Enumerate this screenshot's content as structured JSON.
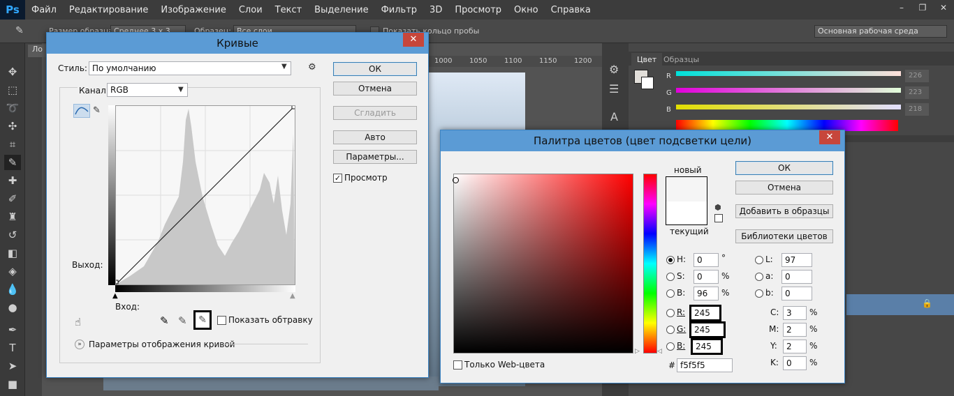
{
  "menu": {
    "logo": "Ps",
    "items": [
      "Файл",
      "Редактирование",
      "Изображение",
      "Слои",
      "Текст",
      "Выделение",
      "Фильтр",
      "3D",
      "Просмотр",
      "Окно",
      "Справка"
    ]
  },
  "window_controls": [
    "–",
    "❐",
    "✕"
  ],
  "options": {
    "sample_size_label": "Размер образца:",
    "sample_size_value": "Среднее 3 х 3",
    "sample_label": "Образец:",
    "sample_value": "Все слои",
    "show_ring": "Показать кольцо пробы",
    "workspace": "Основная рабочая среда"
  },
  "doc_tab": "Ло",
  "ruler_ticks": [
    "1000",
    "1050",
    "1100",
    "1150",
    "1200"
  ],
  "right_panel": {
    "tabs": [
      "Цвет",
      "Образцы"
    ],
    "channels": [
      {
        "label": "R",
        "value": "226"
      },
      {
        "label": "G",
        "value": "223"
      },
      {
        "label": "B",
        "value": "218"
      }
    ]
  },
  "curves": {
    "title": "Кривые",
    "close": "✕",
    "style_label": "Стиль:",
    "style_value": "По умолчанию",
    "channel_label": "Канал:",
    "channel_value": "RGB",
    "output_label": "Выход:",
    "input_label": "Вход:",
    "show_clipping": "Показать обтравку",
    "display_options": "Параметры отображения кривой",
    "preview": "Просмотр",
    "buttons": {
      "ok": "ОК",
      "cancel": "Отмена",
      "smooth": "Сгладить",
      "auto": "Авто",
      "options": "Параметры..."
    }
  },
  "picker": {
    "title": "Палитра цветов (цвет подсветки цели)",
    "close": "✕",
    "new_label": "новый",
    "current_label": "текущий",
    "buttons": {
      "ok": "ОК",
      "cancel": "Отмена",
      "add": "Добавить в образцы",
      "libraries": "Библиотеки цветов"
    },
    "web_only": "Только Web-цвета",
    "hsb": [
      {
        "label": "H:",
        "value": "0",
        "unit": "°"
      },
      {
        "label": "S:",
        "value": "0",
        "unit": "%"
      },
      {
        "label": "B:",
        "value": "96",
        "unit": "%"
      }
    ],
    "rgb": [
      {
        "label": "R:",
        "value": "245"
      },
      {
        "label": "G:",
        "value": "245"
      },
      {
        "label": "B:",
        "value": "245"
      }
    ],
    "lab": [
      {
        "label": "L:",
        "value": "97"
      },
      {
        "label": "a:",
        "value": "0"
      },
      {
        "label": "b:",
        "value": "0"
      }
    ],
    "cmyk": [
      {
        "label": "C:",
        "value": "3",
        "unit": "%"
      },
      {
        "label": "M:",
        "value": "2",
        "unit": "%"
      },
      {
        "label": "Y:",
        "value": "2",
        "unit": "%"
      },
      {
        "label": "K:",
        "value": "0",
        "unit": "%"
      }
    ],
    "hex_label": "#",
    "hex_value": "f5f5f5"
  }
}
